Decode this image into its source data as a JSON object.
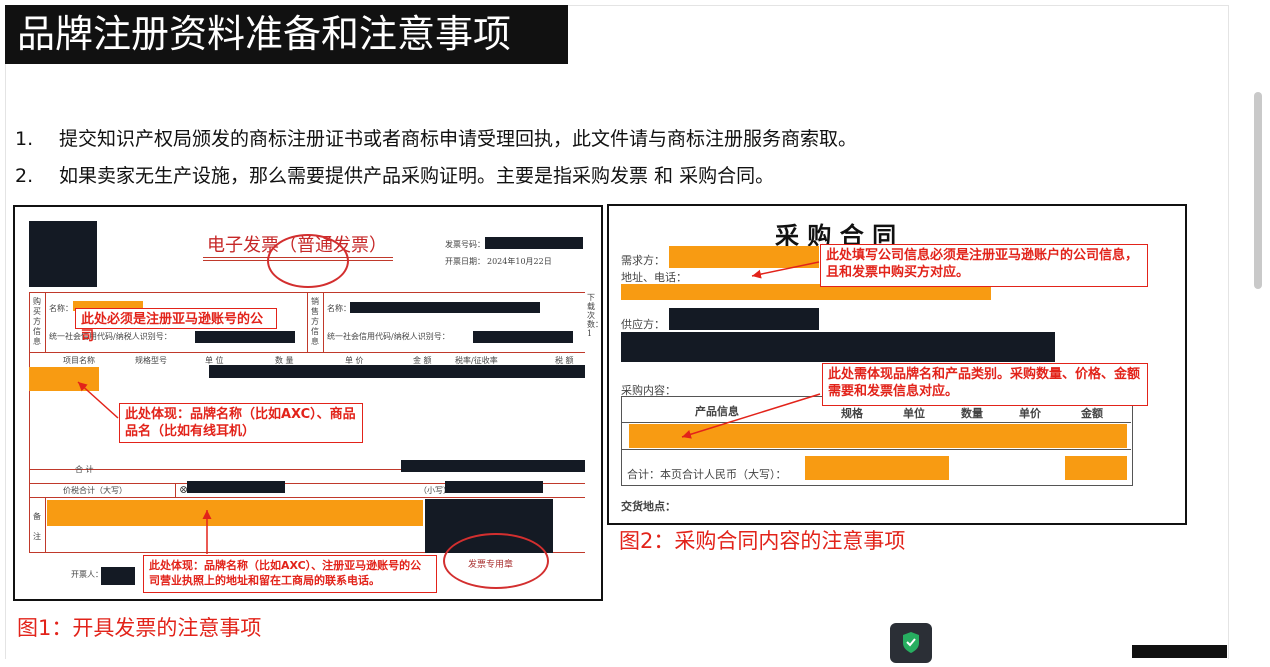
{
  "header": {
    "title": "品牌注册资料准备和注意事项"
  },
  "list": [
    {
      "num": "1.",
      "text": "提交知识产权局颁发的商标注册证书或者商标申请受理回执，此文件请与商标注册服务商索取。"
    },
    {
      "num": "2.",
      "text": "如果卖家无生产设施，那么需要提供产品采购证明。主要是指采购发票 和 采购合同。"
    }
  ],
  "invoice": {
    "title": "电子发票（普通发票）",
    "invoice_no_label": "发票号码：",
    "date_label": "开票日期：",
    "date_value": "2024年10月22日",
    "buyer_side": "购买方信息",
    "seller_side": "销售方信息",
    "name_label": "名称：",
    "tax_id_label": "统一社会信用代码/纳税人识别号：",
    "col_headers": [
      "项目名称",
      "规格型号",
      "单 位",
      "数 量",
      "单 价",
      "金 额",
      "税率/征收率",
      "税 额"
    ],
    "total_label": "合 计",
    "total_tax_label": "价税合计（大写）",
    "small_label": "（小写）",
    "remarks_label": "备注",
    "issuer_label": "开票人：",
    "download_count": "下载次数：1",
    "seal_text": "发票专用章",
    "note_buyer": "此处必须是注册亚马逊账号的公司",
    "note_item": "此处体现：品牌名称（比如AXC）、商品品名（比如有线耳机）",
    "note_remark": "此处体现：品牌名称（比如AXC）、注册亚马逊账号的公司营业执照上的地址和留在工商局的联系电话。"
  },
  "contract": {
    "title": "采 购 合 同",
    "buyer_label": "需求方：",
    "address_label": "地址、电话：",
    "supplier_label": "供应方：",
    "content_label": "采购内容：",
    "col_headers": [
      "产品信息",
      "规格",
      "单位",
      "数量",
      "单价",
      "金额"
    ],
    "total_label": "合计：本页合计人民币（大写）：",
    "delivery_label": "交货地点：",
    "note_company": "此处填写公司信息必须是注册亚马逊账户的公司信息，且和发票中购买方对应。",
    "note_product": "此处需体现品牌名和产品类别。采购数量、价格、金额需要和发票信息对应。"
  },
  "captions": {
    "fig1": "图1：开具发票的注意事项",
    "fig2": "图2：采购合同内容的注意事项"
  },
  "colors": {
    "highlight": "#f89b12",
    "annotation": "#e2231a",
    "title_bg": "#111111"
  }
}
